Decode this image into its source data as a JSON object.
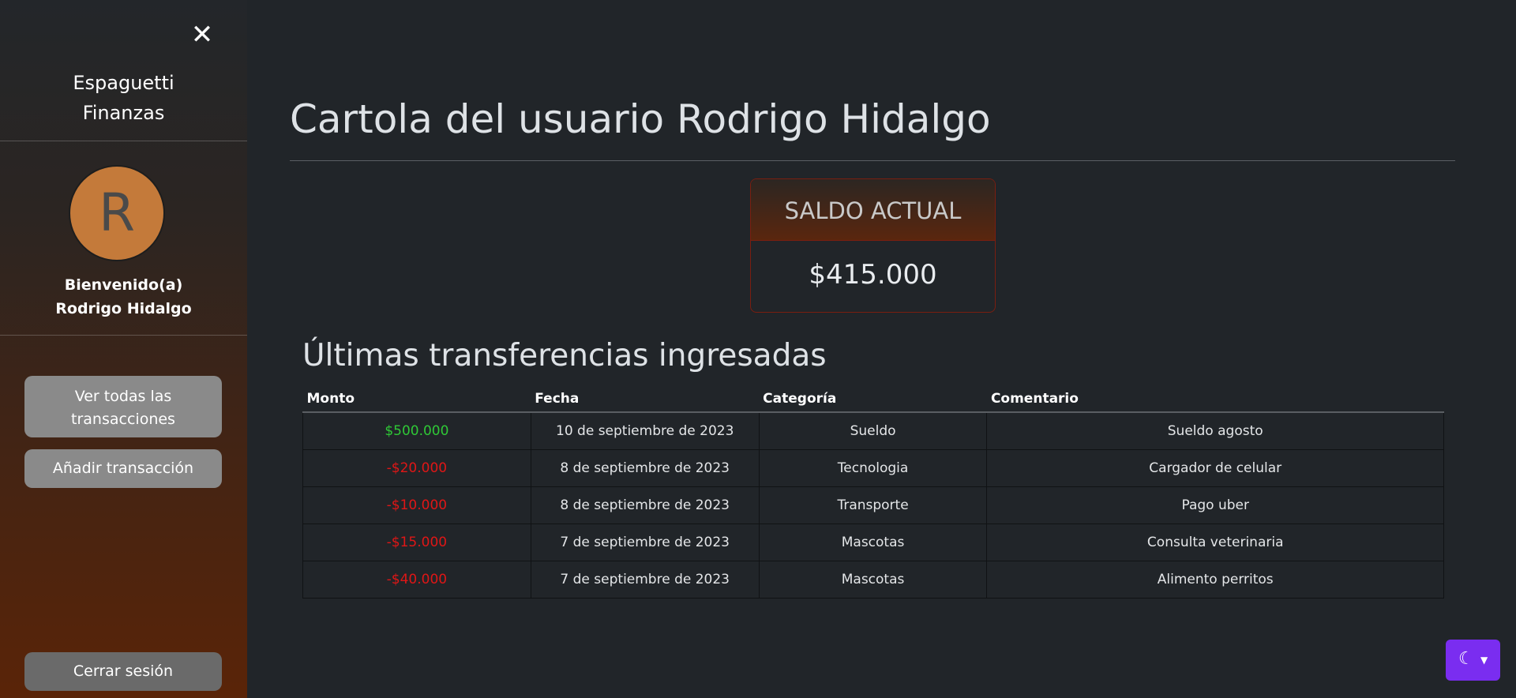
{
  "sidebar": {
    "close_icon": "close-icon",
    "brand": {
      "line1": "Espaguetti",
      "line2": "Finanzas"
    },
    "avatar_letter": "R",
    "welcome": {
      "line1": "Bienvenido(a)",
      "line2": "Rodrigo Hidalgo"
    },
    "view_all_label": {
      "line1": "Ver todas las",
      "line2": "transacciones"
    },
    "add_label": "Añadir transacción",
    "logout_label": "Cerrar sesión"
  },
  "main": {
    "title": "Cartola del usuario Rodrigo Hidalgo",
    "balance": {
      "label": "SALDO ACTUAL",
      "value": "$415.000"
    },
    "section_title": "Últimas transferencias ingresadas",
    "table": {
      "headers": [
        "Monto",
        "Fecha",
        "Categoría",
        "Comentario"
      ],
      "rows": [
        {
          "amount": "$500.000",
          "date": "10 de septiembre de 2023",
          "category": "Sueldo",
          "comment": "Sueldo agosto"
        },
        {
          "amount": "-$20.000",
          "date": "8 de septiembre de 2023",
          "category": "Tecnologia",
          "comment": "Cargador de celular"
        },
        {
          "amount": "-$10.000",
          "date": "8 de septiembre de 2023",
          "category": "Transporte",
          "comment": "Pago uber"
        },
        {
          "amount": "-$15.000",
          "date": "7 de septiembre de 2023",
          "category": "Mascotas",
          "comment": "Consulta veterinaria"
        },
        {
          "amount": "-$40.000",
          "date": "7 de septiembre de 2023",
          "category": "Mascotas",
          "comment": "Alimento perritos"
        }
      ]
    }
  },
  "theme_toggle": {
    "icon": "moon-stars-icon",
    "caret_icon": "chevron-down-icon",
    "color": "#7a2df0"
  },
  "colors": {
    "positive_amount": "#2fc936",
    "negative_amount": "#e01616",
    "background": "#212529"
  }
}
